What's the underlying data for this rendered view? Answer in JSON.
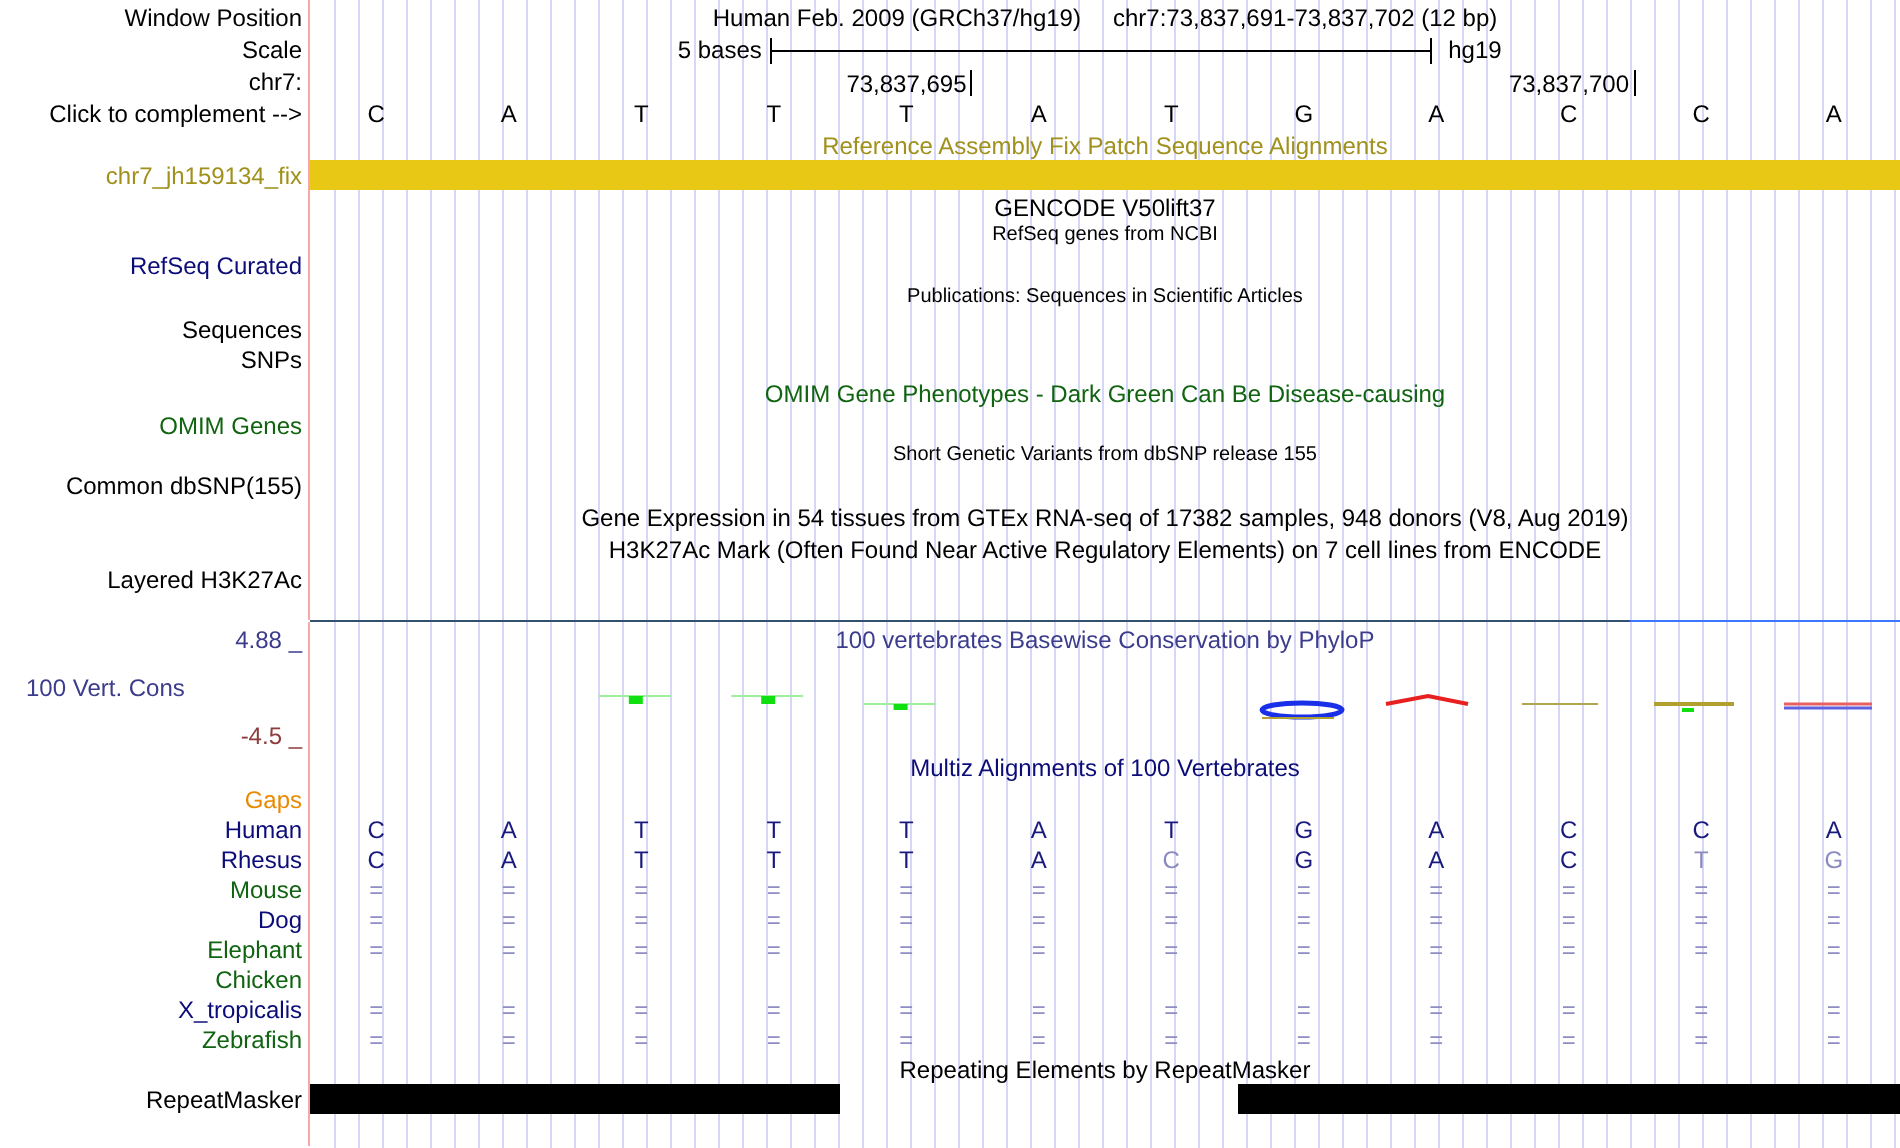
{
  "window_position": {
    "label": "Window Position",
    "assembly": "Human Feb. 2009 (GRCh37/hg19)",
    "range": "chr7:73,837,691-73,837,702 (12 bp)"
  },
  "scale": {
    "label": "Scale",
    "span": "5 bases",
    "assembly": "hg19"
  },
  "coordinates": {
    "label": "chr7:",
    "ticks": [
      "73,837,695",
      "73,837,700"
    ]
  },
  "sequence": {
    "label": "Click to complement -->",
    "bases": [
      "C",
      "A",
      "T",
      "T",
      "T",
      "A",
      "T",
      "G",
      "A",
      "C",
      "C",
      "A"
    ]
  },
  "fix_patch": {
    "title": "Reference Assembly Fix Patch Sequence Alignments",
    "label": "chr7_jh159134_fix"
  },
  "gencode": {
    "title": "GENCODE V50lift37"
  },
  "refseq": {
    "title": "RefSeq genes from NCBI",
    "label": "RefSeq Curated"
  },
  "publications": {
    "title": "Publications: Sequences in Scientific Articles",
    "labels": [
      "Sequences",
      "SNPs"
    ]
  },
  "omim": {
    "title": "OMIM Gene Phenotypes - Dark Green Can Be Disease-causing",
    "label": "OMIM Genes"
  },
  "dbsnp": {
    "title": "Short Genetic Variants from dbSNP release 155",
    "label": "Common dbSNP(155)"
  },
  "gtex": {
    "title": "Gene Expression in 54 tissues from GTEx RNA-seq of 17382 samples, 948 donors (V8, Aug 2019)"
  },
  "h3k27ac": {
    "title": "H3K27Ac Mark (Often Found Near Active Regulatory Elements) on 7 cell lines from ENCODE",
    "label": "Layered H3K27Ac"
  },
  "phylop": {
    "title": "100 vertebrates Basewise Conservation by PhyloP",
    "label": "100 Vert. Cons",
    "max_label": "4.88 _",
    "min_label": "-4.5 _"
  },
  "multiz": {
    "title": "Multiz Alignments of 100 Vertebrates",
    "gaps_label": "Gaps",
    "species": [
      {
        "name": "Human",
        "color": "#0c0c78",
        "bases": [
          {
            "text": "C",
            "mismatch": false
          },
          {
            "text": "A",
            "mismatch": false
          },
          {
            "text": "T",
            "mismatch": false
          },
          {
            "text": "T",
            "mismatch": false
          },
          {
            "text": "T",
            "mismatch": false
          },
          {
            "text": "A",
            "mismatch": false
          },
          {
            "text": "T",
            "mismatch": false
          },
          {
            "text": "G",
            "mismatch": false
          },
          {
            "text": "A",
            "mismatch": false
          },
          {
            "text": "C",
            "mismatch": false
          },
          {
            "text": "C",
            "mismatch": false
          },
          {
            "text": "A",
            "mismatch": false
          }
        ]
      },
      {
        "name": "Rhesus",
        "color": "#0c0c78",
        "bases": [
          {
            "text": "C",
            "mismatch": false
          },
          {
            "text": "A",
            "mismatch": false
          },
          {
            "text": "T",
            "mismatch": false
          },
          {
            "text": "T",
            "mismatch": false
          },
          {
            "text": "T",
            "mismatch": false
          },
          {
            "text": "A",
            "mismatch": false
          },
          {
            "text": "C",
            "mismatch": true
          },
          {
            "text": "G",
            "mismatch": false
          },
          {
            "text": "A",
            "mismatch": false
          },
          {
            "text": "C",
            "mismatch": false
          },
          {
            "text": "T",
            "mismatch": true
          },
          {
            "text": "G",
            "mismatch": true
          }
        ]
      },
      {
        "name": "Mouse",
        "color": "#106410",
        "bases": [
          {
            "text": "="
          },
          {
            "text": "="
          },
          {
            "text": "="
          },
          {
            "text": "="
          },
          {
            "text": "="
          },
          {
            "text": "="
          },
          {
            "text": "="
          },
          {
            "text": "="
          },
          {
            "text": "="
          },
          {
            "text": "="
          },
          {
            "text": "="
          },
          {
            "text": "="
          }
        ]
      },
      {
        "name": "Dog",
        "color": "#0c0c78",
        "bases": [
          {
            "text": "="
          },
          {
            "text": "="
          },
          {
            "text": "="
          },
          {
            "text": "="
          },
          {
            "text": "="
          },
          {
            "text": "="
          },
          {
            "text": "="
          },
          {
            "text": "="
          },
          {
            "text": "="
          },
          {
            "text": "="
          },
          {
            "text": "="
          },
          {
            "text": "="
          }
        ]
      },
      {
        "name": "Elephant",
        "color": "#106410",
        "bases": [
          {
            "text": "="
          },
          {
            "text": "="
          },
          {
            "text": "="
          },
          {
            "text": "="
          },
          {
            "text": "="
          },
          {
            "text": "="
          },
          {
            "text": "="
          },
          {
            "text": "="
          },
          {
            "text": "="
          },
          {
            "text": "="
          },
          {
            "text": "="
          },
          {
            "text": "="
          }
        ]
      },
      {
        "name": "Chicken",
        "color": "#106410"
      },
      {
        "name": "X_tropicalis",
        "color": "#0c0c78",
        "bases": [
          {
            "text": "="
          },
          {
            "text": "="
          },
          {
            "text": "="
          },
          {
            "text": "="
          },
          {
            "text": "="
          },
          {
            "text": "="
          },
          {
            "text": "="
          },
          {
            "text": "="
          },
          {
            "text": "="
          },
          {
            "text": "="
          },
          {
            "text": "="
          },
          {
            "text": "="
          }
        ]
      },
      {
        "name": "Zebrafish",
        "color": "#106410",
        "bases": [
          {
            "text": "="
          },
          {
            "text": "="
          },
          {
            "text": "="
          },
          {
            "text": "="
          },
          {
            "text": "="
          },
          {
            "text": "="
          },
          {
            "text": "="
          },
          {
            "text": "="
          },
          {
            "text": "="
          },
          {
            "text": "="
          },
          {
            "text": "="
          },
          {
            "text": "="
          }
        ]
      }
    ]
  },
  "repeatmasker": {
    "title": "Repeating Elements by RepeatMasker",
    "label": "RepeatMasker",
    "masked": [
      true,
      true,
      true,
      true,
      false,
      false,
      false,
      true,
      true,
      true,
      true,
      true
    ]
  }
}
